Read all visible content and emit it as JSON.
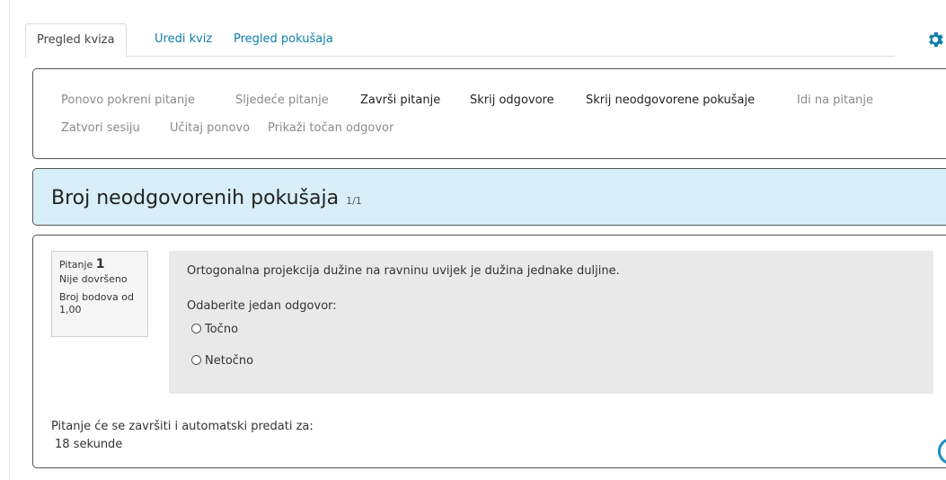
{
  "tabs": [
    {
      "label": "Pregled kviza",
      "active": true
    },
    {
      "label": "Uredi kviz",
      "active": false
    },
    {
      "label": "Pregled pokušaja",
      "active": false
    }
  ],
  "settings_icon": "gear-icon",
  "controls": [
    {
      "label": "Ponovo pokreni pitanje",
      "enabled": false
    },
    {
      "label": "Sljedeće pitanje",
      "enabled": false
    },
    {
      "label": "Završi pitanje",
      "enabled": true
    },
    {
      "label": "Skrij odgovore",
      "enabled": true
    },
    {
      "label": "Skrij neodgovorene pokušaje",
      "enabled": true
    },
    {
      "label": "Idi na pitanje",
      "enabled": false
    },
    {
      "label": "Zatvori sesiju",
      "enabled": false
    },
    {
      "label": "Učitaj ponovo",
      "enabled": false
    },
    {
      "label": "Prikaži točan odgovor",
      "enabled": false
    }
  ],
  "header": {
    "title": "Broj neodgovorenih pokušaja",
    "count": "1/1",
    "background": "#d8eef8"
  },
  "question": {
    "label": "Pitanje",
    "number": "1",
    "status": "Nije dovršeno",
    "points": "Broj bodova od 1,00",
    "text": "Ortogonalna projekcija dužine na ravninu uvijek je dužina jednake duljine.",
    "prompt": "Odaberite jedan odgovor:",
    "options": [
      "Točno",
      "Netočno"
    ]
  },
  "timer": {
    "text": "Pitanje će se završiti i automatski predati za:",
    "value": "18 sekunde"
  },
  "accent": "#0f7fa8"
}
